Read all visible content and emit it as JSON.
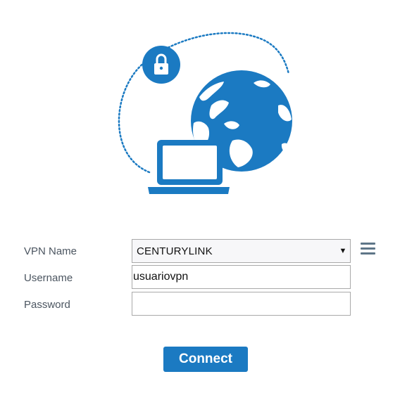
{
  "illustration": {
    "lock_icon": "lock-icon",
    "globe_icon": "globe-icon",
    "laptop_icon": "laptop-icon",
    "accent_color": "#1b7ac2"
  },
  "form": {
    "vpn_name_label": "VPN Name",
    "username_label": "Username",
    "password_label": "Password",
    "vpn_name_value": "CENTURYLINK",
    "username_value": "usuariovpn",
    "password_value": "",
    "dropdown_arrow": "▼",
    "menu_icon": "hamburger-menu-icon"
  },
  "actions": {
    "connect_label": "Connect"
  }
}
